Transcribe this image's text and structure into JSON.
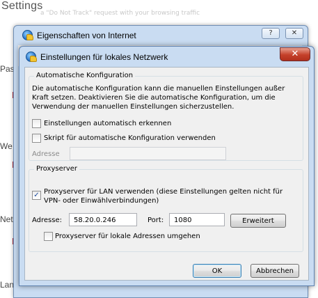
{
  "background": {
    "title": "Settings",
    "faint_text": "a \"Do Not Track\" request with your browsing traffic",
    "labels": [
      "Pas",
      "We",
      "Net",
      "Lan"
    ]
  },
  "outer_dialog": {
    "title": "Eigenschaften von Internet",
    "help_glyph": "?",
    "close_glyph": "✕"
  },
  "inner_dialog": {
    "title": "Einstellungen für lokales Netzwerk",
    "close_glyph": "✕",
    "auto_config": {
      "legend": "Automatische Konfiguration",
      "description": "Die automatische Konfiguration kann die manuellen Einstellungen außer Kraft setzen. Deaktivieren Sie die automatische Konfiguration, um die Verwendung der manuellen Einstellungen sicherzustellen.",
      "detect_label": "Einstellungen automatisch erkennen",
      "detect_checked": false,
      "script_label": "Skript für automatische Konfiguration verwenden",
      "script_checked": false,
      "address_label": "Adresse",
      "address_value": ""
    },
    "proxy": {
      "legend": "Proxyserver",
      "use_proxy_label": "Proxyserver für LAN verwenden (diese Einstellungen gelten nicht für VPN- oder Einwählverbindungen)",
      "use_proxy_checked": true,
      "check_glyph": "✓",
      "address_label": "Adresse:",
      "address_value": "58.20.0.246",
      "port_label": "Port:",
      "port_value": "1080",
      "advanced_label": "Erweitert",
      "bypass_label": "Proxyserver für lokale Adressen umgehen",
      "bypass_checked": false
    },
    "ok_label": "OK",
    "cancel_label": "Abbrechen"
  }
}
